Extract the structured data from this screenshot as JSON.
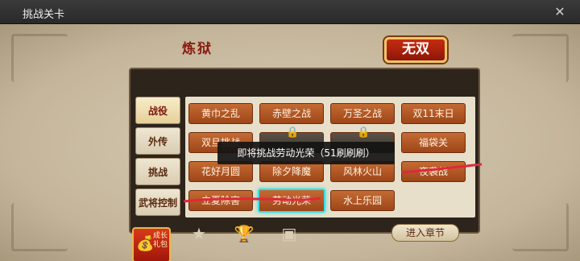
{
  "window": {
    "title": "挑战关卡",
    "close_icon": "close-icon"
  },
  "header": {
    "chapter": "炼狱",
    "mode": "无双"
  },
  "tabs": [
    "战役",
    "外传",
    "挑战",
    "武将控制"
  ],
  "levels": [
    [
      "黄巾之乱",
      "赤壁之战",
      "万圣之战",
      "双11末日"
    ],
    [
      "双旦挑战",
      "",
      "",
      "福袋关"
    ],
    [
      "花好月圆",
      "除夕降魔",
      "风林火山",
      "夜袭战"
    ],
    [
      "立夏除害",
      "劳动光荣",
      "水上乐园"
    ]
  ],
  "toast": "即将挑战劳动光荣（51刷刷刷）",
  "bottom": {
    "enter": "进入章节"
  },
  "gift": {
    "label": "成长礼包"
  },
  "colors": {
    "accent": "#38e0e6",
    "level_btn": "#b5582a",
    "annotation": "#e0283a"
  }
}
